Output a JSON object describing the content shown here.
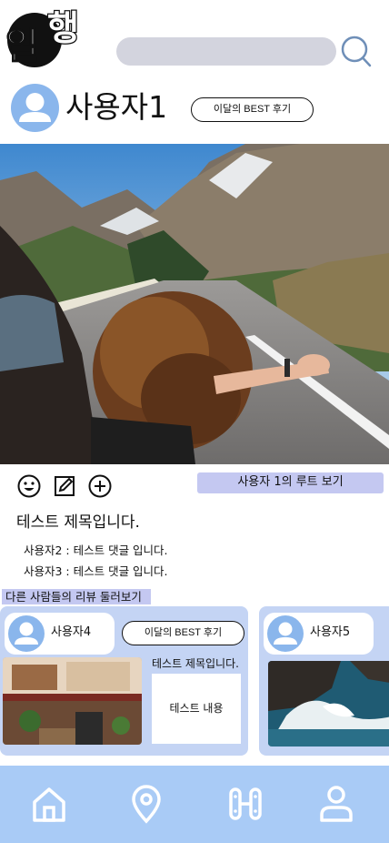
{
  "logo": {
    "text_top": "행",
    "text_bottom": "일"
  },
  "header": {
    "search_icon": "search-icon"
  },
  "profile": {
    "username": "사용자1",
    "best_review_label": "이달의 BEST 후기",
    "avatar_icon": "user-avatar-icon"
  },
  "actions": {
    "icons": [
      "smile-icon",
      "edit-icon",
      "plus-circle-icon"
    ],
    "route_button": "사용자 1의 루트 보기"
  },
  "post": {
    "title": "테스트 제목입니다.",
    "comments": [
      "사용자2 : 테스트 댓글 입니다.",
      "사용자3 : 테스트 댓글 입니다."
    ]
  },
  "other_reviews": {
    "section_label": "다른 사람들의 리뷰 둘러보기",
    "cards": [
      {
        "username": "사용자4",
        "best_label": "이달의 BEST 후기",
        "title": "테스트 제목입니다.",
        "content": "테스트 내용"
      },
      {
        "username": "사용자5"
      }
    ]
  },
  "tabbar": {
    "icons": [
      "home-icon",
      "map-pin-icon",
      "route-icon",
      "profile-icon"
    ]
  },
  "colors": {
    "accent_blue": "#8ab6ec",
    "route_button_bg": "#c4c8f1",
    "card_bg": "#c4d4f4",
    "tabbar_bg": "#a9cbf6",
    "search_bg": "#d3d4de"
  }
}
